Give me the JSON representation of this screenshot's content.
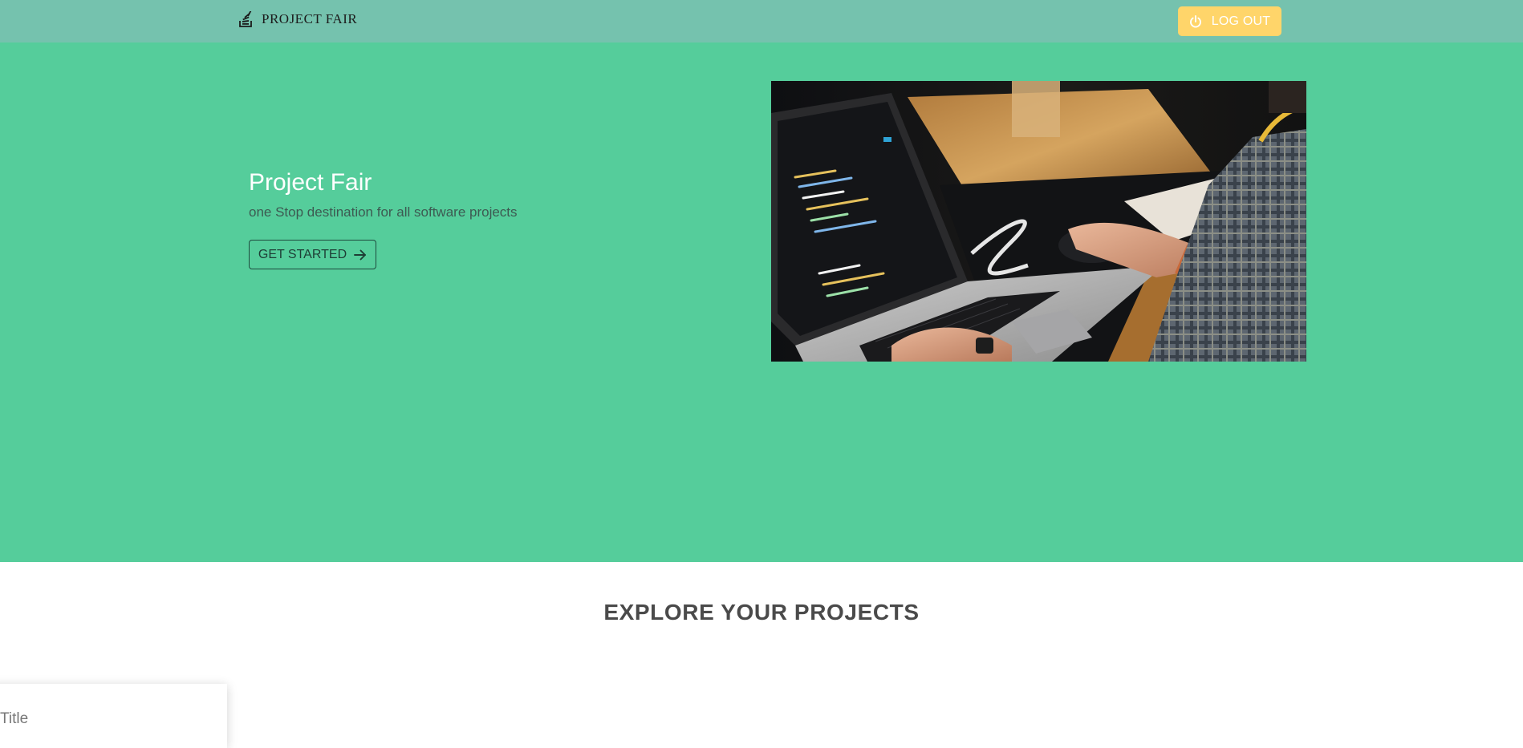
{
  "navbar": {
    "brand_text": "PROJECT FAIR",
    "brand_icon": "stack-overflow-icon",
    "logout_label": "LOG OUT",
    "logout_icon": "power-icon",
    "colors": {
      "background": "#75c2ae",
      "logout_button": "#ffd56a"
    }
  },
  "hero": {
    "title": "Project Fair",
    "subtitle": "one Stop destination for all software projects",
    "cta_label": "GET STARTED",
    "cta_icon": "arrow-right-icon",
    "image": "person-coding-on-laptop",
    "colors": {
      "background": "#55cd9b"
    }
  },
  "explore": {
    "heading": "EXPLORE YOUR PROJECTS",
    "cards": [
      {
        "title": "Title"
      }
    ]
  }
}
